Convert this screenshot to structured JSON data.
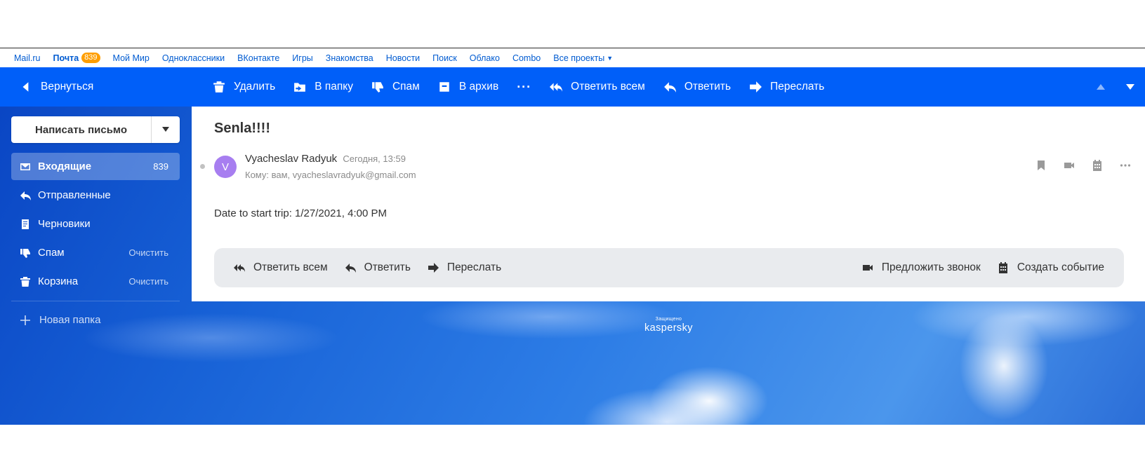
{
  "portal": {
    "links": [
      {
        "label": "Mail.ru"
      },
      {
        "label": "Почта",
        "badge": "839",
        "active": true
      },
      {
        "label": "Мой Мир"
      },
      {
        "label": "Одноклассники"
      },
      {
        "label": "ВКонтакте"
      },
      {
        "label": "Игры"
      },
      {
        "label": "Знакомства"
      },
      {
        "label": "Новости"
      },
      {
        "label": "Поиск"
      },
      {
        "label": "Облако"
      },
      {
        "label": "Combo"
      },
      {
        "label": "Все проекты"
      }
    ]
  },
  "toolbar": {
    "back_label": "Вернуться",
    "delete_label": "Удалить",
    "move_label": "В папку",
    "spam_label": "Спам",
    "archive_label": "В архив",
    "more_label": "···",
    "reply_all_label": "Ответить всем",
    "reply_label": "Ответить",
    "forward_label": "Переслать"
  },
  "sidebar": {
    "compose_label": "Написать письмо",
    "folders": [
      {
        "label": "Входящие",
        "count": "839",
        "icon": "inbox-icon",
        "active": true
      },
      {
        "label": "Отправленные",
        "icon": "sent-icon"
      },
      {
        "label": "Черновики",
        "icon": "drafts-icon"
      },
      {
        "label": "Спам",
        "icon": "spam-icon",
        "action": "Очистить"
      },
      {
        "label": "Корзина",
        "icon": "trash-icon",
        "action": "Очистить"
      }
    ],
    "new_folder_label": "Новая папка"
  },
  "message": {
    "subject": "Senla!!!!",
    "avatar_letter": "V",
    "sender": "Vyacheslav Radyuk",
    "date": "Сегодня, 13:59",
    "to": "Кому: вам, vyacheslavradyuk@gmail.com",
    "body": "Date to start trip: 1/27/2021, 4:00 PM"
  },
  "reply_bar": {
    "reply_all_label": "Ответить всем",
    "reply_label": "Ответить",
    "forward_label": "Переслать",
    "call_label": "Предложить звонок",
    "event_label": "Создать событие"
  },
  "footer": {
    "protected_label": "Защищено",
    "brand": "kaspersky"
  },
  "colors": {
    "toolbar": "#005ff9",
    "badge": "#ff9e00",
    "avatar": "#a77ef0",
    "link": "#005bd1"
  }
}
